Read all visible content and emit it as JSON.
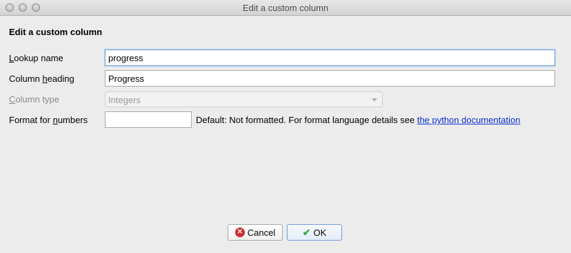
{
  "window": {
    "title": "Edit a custom column"
  },
  "dialog": {
    "heading": "Edit a custom column",
    "lookup_name": {
      "label_pre": "",
      "label_u": "L",
      "label_post": "ookup name",
      "value": "progress"
    },
    "column_heading": {
      "label_pre": "Column ",
      "label_u": "h",
      "label_post": "eading",
      "value": "Progress"
    },
    "column_type": {
      "label_pre": "",
      "label_u": "C",
      "label_post": "olumn type",
      "value": "Integers"
    },
    "format_numbers": {
      "label_pre": "Format for ",
      "label_u": "n",
      "label_post": "umbers",
      "value": "",
      "note": "Default: Not formatted. For format language details see ",
      "link": "the python documentation"
    }
  },
  "buttons": {
    "cancel": "Cancel",
    "ok": "OK"
  },
  "icons": {
    "cancel": "cancel-x-icon",
    "ok": "checkmark-icon"
  },
  "colors": {
    "link": "#0b2fd0",
    "focus_border": "#6fa3dc",
    "cancel_icon": "#d22a2a",
    "ok_icon": "#3da43d"
  }
}
